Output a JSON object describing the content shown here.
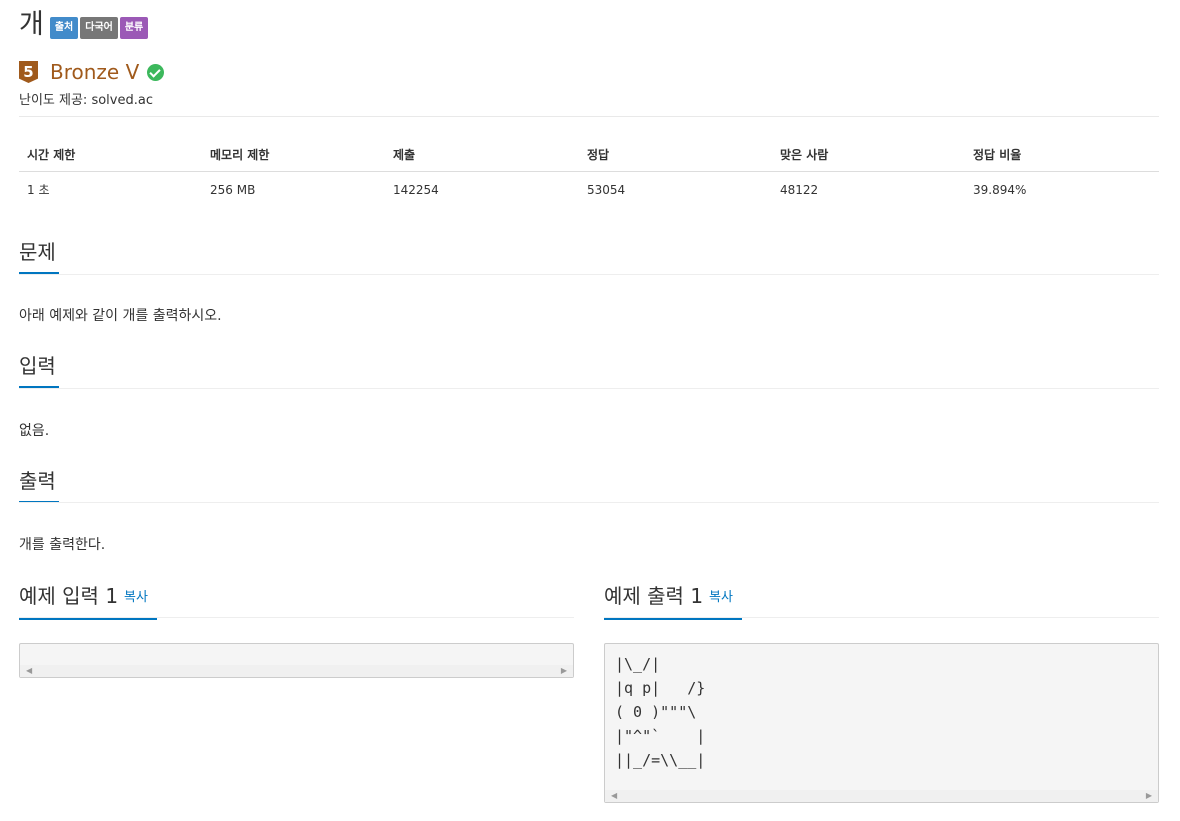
{
  "problem": {
    "title": "개",
    "badges": [
      "출처",
      "다국어",
      "분류"
    ],
    "tier_number": "5",
    "tier_name": "Bronze V",
    "difficulty_provider": "난이도 제공: solved.ac"
  },
  "stats": {
    "headers": [
      "시간 제한",
      "메모리 제한",
      "제출",
      "정답",
      "맞은 사람",
      "정답 비율"
    ],
    "values": [
      "1 초",
      "256 MB",
      "142254",
      "53054",
      "48122",
      "39.894%"
    ]
  },
  "sections": {
    "problem": {
      "heading": "문제",
      "body": "아래 예제와 같이 개를 출력하시오."
    },
    "input": {
      "heading": "입력",
      "body": "없음."
    },
    "output": {
      "heading": "출력",
      "body": "개를 출력한다."
    }
  },
  "samples": {
    "input_heading": "예제 입력 1",
    "output_heading": "예제 출력 1",
    "copy_label": "복사",
    "input_text": "",
    "output_text": "|\\_/|\n|q p|   /}\n( 0 )\"\"\"\\\n|\"^\"`    |\n||_/=\\\\__|"
  },
  "colors": {
    "accent": "#0076c0",
    "bronze": "#a05a1c",
    "verified": "#3cb85c"
  }
}
